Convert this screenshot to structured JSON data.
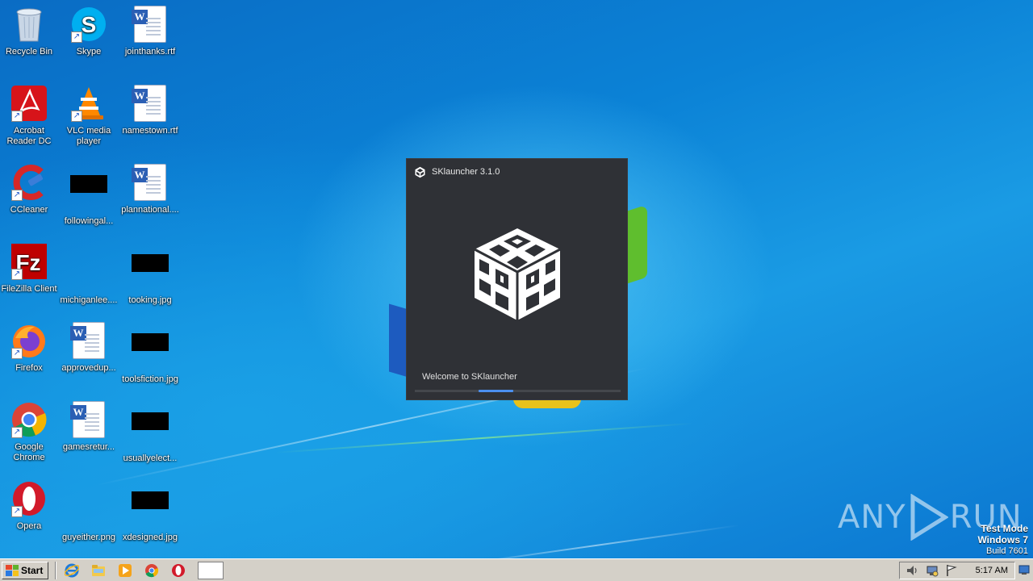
{
  "desktop": {
    "icons": [
      {
        "label": "Recycle Bin",
        "icon": "recycle-bin-icon"
      },
      {
        "label": "Skype",
        "icon": "skype-icon"
      },
      {
        "label": "jointhanks.rtf",
        "icon": "word-document-icon"
      },
      {
        "label": "Acrobat Reader DC",
        "icon": "acrobat-icon"
      },
      {
        "label": "VLC media player",
        "icon": "vlc-icon"
      },
      {
        "label": "namestown.rtf",
        "icon": "word-document-icon"
      },
      {
        "label": "CCleaner",
        "icon": "ccleaner-icon"
      },
      {
        "label": "followingal...",
        "icon": "image-file-icon"
      },
      {
        "label": "plannational....",
        "icon": "word-document-icon"
      },
      {
        "label": "FileZilla Client",
        "icon": "filezilla-icon"
      },
      {
        "label": "michiganlee....",
        "icon": "file-icon"
      },
      {
        "label": "tooking.jpg",
        "icon": "image-file-icon"
      },
      {
        "label": "Firefox",
        "icon": "firefox-icon"
      },
      {
        "label": "approvedup...",
        "icon": "word-document-icon"
      },
      {
        "label": "toolsfiction.jpg",
        "icon": "image-file-icon"
      },
      {
        "label": "Google Chrome",
        "icon": "chrome-icon"
      },
      {
        "label": "gamesretur...",
        "icon": "word-document-icon"
      },
      {
        "label": "usuallyelect...",
        "icon": "image-file-icon"
      },
      {
        "label": "Opera",
        "icon": "opera-icon"
      },
      {
        "label": "guyeither.png",
        "icon": "file-icon"
      },
      {
        "label": "xdesigned.jpg",
        "icon": "image-file-icon"
      }
    ]
  },
  "sklauncher": {
    "title": "SKlauncher 3.1.0",
    "status": "Welcome to SKlauncher",
    "progress_start": 0.31,
    "progress_end": 0.48,
    "accent_color": "#4b90f0",
    "background_color": "#2f3136"
  },
  "taskbar": {
    "start_label": "Start",
    "quick_launch": [
      "internet-explorer-icon",
      "explorer-folder-icon",
      "media-player-icon",
      "chrome-icon",
      "opera-icon"
    ],
    "clock": "5:17 AM"
  },
  "watermark": {
    "brand": "ANY",
    "brand_suffix": "RUN",
    "mode": "Test Mode",
    "os": "Windows 7",
    "build": "Build 7601"
  }
}
